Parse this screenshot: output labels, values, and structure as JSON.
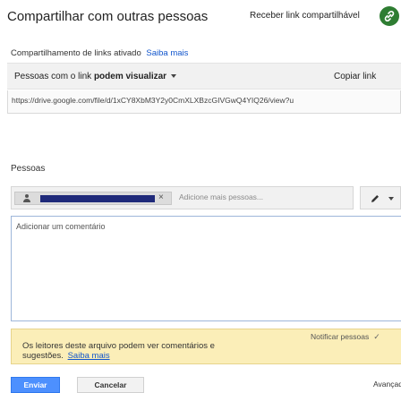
{
  "dialog": {
    "title": "Compartilhar com outras pessoas",
    "link_toggle_label": "Receber link compartilhável",
    "link_icon": "link-icon",
    "link_icon_color": "#2e7d32"
  },
  "link_sharing": {
    "status": "Compartilhamento de links ativado",
    "learn_more": "Saiba mais",
    "access_prefix": "Pessoas com o link ",
    "access_level": "podem visualizar",
    "copy_link": "Copiar link",
    "url": "https://drive.google.com/file/d/1xCY8XbM3Y2y0CmXLXBzcGIVGwQ4YIQ26/view?u"
  },
  "people": {
    "heading": "Pessoas",
    "add_placeholder": "Adicione mais pessoas...",
    "chip_remove": "×",
    "permission_icon": "pencil-icon"
  },
  "comment": {
    "placeholder": "Adicionar um comentário"
  },
  "notice": {
    "text": "Os leitores deste arquivo podem ver comentários e sugestões.",
    "learn_more": "Saiba mais",
    "notify_label": "Notificar pessoas",
    "check": "✓",
    "background_color": "#fbeeb8"
  },
  "footer": {
    "send": "Enviar",
    "cancel": "Cancelar",
    "advanced": "Avançado"
  },
  "colors": {
    "primary_button": "#4d90fe",
    "link": "#1155cc"
  }
}
